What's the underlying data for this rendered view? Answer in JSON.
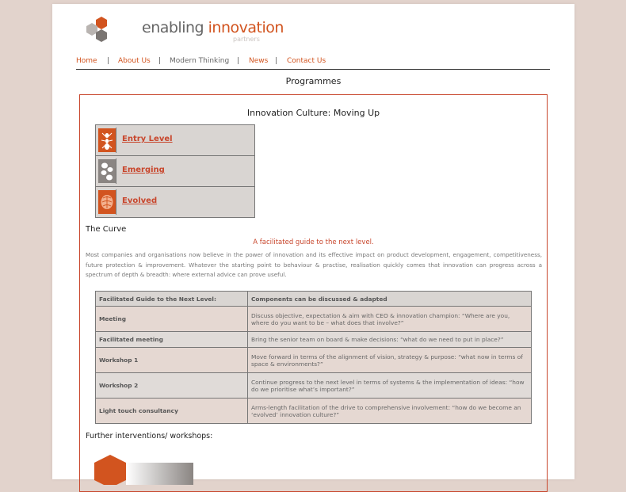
{
  "logo": {
    "text_main": "enabling ",
    "text_accent": "innovation",
    "sub": "partners"
  },
  "nav": {
    "items": [
      "Home",
      "About Us",
      "Modern Thinking",
      "News",
      "Contact Us"
    ],
    "separator": "|"
  },
  "page_heading": "Programmes",
  "box_title": "Innovation Culture: Moving Up",
  "levels": [
    {
      "label": "Entry Level",
      "icon": "ant-icon"
    },
    {
      "label": "Emerging",
      "icon": "cells-icon"
    },
    {
      "label": "Evolved",
      "icon": "brain-icon"
    }
  ],
  "curve_title": "The Curve",
  "tagline": "A facilitated guide to the next level.",
  "paragraph": "Most companies and organisations now believe in the power of innovation and its effective impact on product development, engagement, competitiveness, future protection & improvement. Whatever the starting point to behaviour & practise, realisation quickly comes that innovation can progress across a spectrum of depth & breadth: where external advice can prove useful.",
  "table": {
    "headers": [
      "Facilitated Guide to the Next Level:",
      "Components can be discussed & adapted"
    ],
    "rows": [
      [
        "Meeting",
        "Discuss objective, expectation & aim with CEO & innovation champion: “Where are you, where do you want to be – what does that involve?”"
      ],
      [
        "Facilitated meeting",
        "Bring the senior team on board & make decisions: “what do we need to put in place?”"
      ],
      [
        "Workshop 1",
        "Move forward in terms of the alignment of vision, strategy & purpose: “what now in terms of space & environments?”"
      ],
      [
        "Workshop 2",
        "Continue progress to the next level in terms of systems & the implementation of ideas: “how do we prioritise what’s important?”"
      ],
      [
        "Light touch consultancy",
        "Arms-length facilitation of the drive to comprehensive involvement: “how do we become an ‘evolved’ innovation culture?”"
      ]
    ]
  },
  "further_title": "Further interventions/ workshops:",
  "colors": {
    "accent": "#d2541f",
    "border": "#c8462c",
    "page_bg": "#e2d3cc"
  }
}
